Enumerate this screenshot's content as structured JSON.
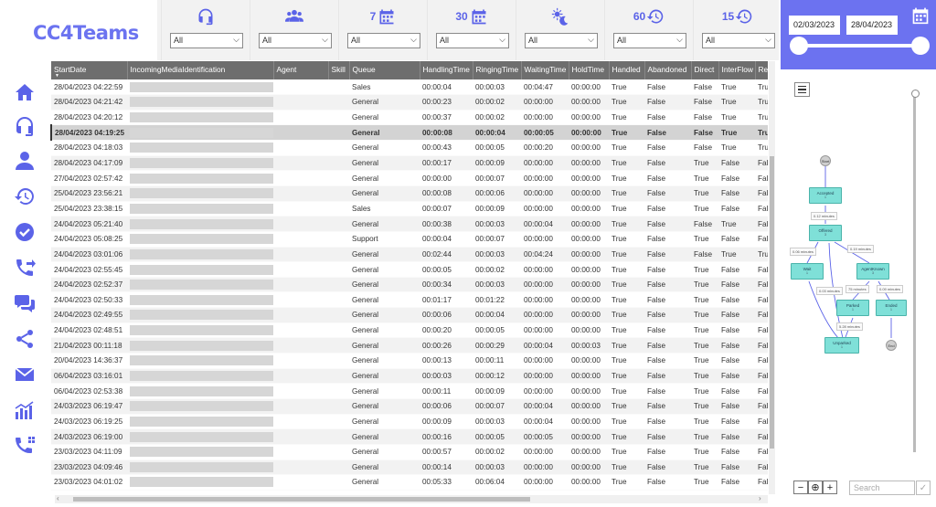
{
  "app": {
    "logo_text": "CC4Teams"
  },
  "sidebar": {
    "items": [
      {
        "icon": "home-icon"
      },
      {
        "icon": "headset-icon"
      },
      {
        "icon": "person-icon"
      },
      {
        "icon": "history-icon"
      },
      {
        "icon": "check-circle-icon"
      },
      {
        "icon": "phone-transfer-icon"
      },
      {
        "icon": "chat-icon"
      },
      {
        "icon": "share-icon"
      },
      {
        "icon": "mail-icon"
      },
      {
        "icon": "chart-icon"
      },
      {
        "icon": "phone-network-icon"
      }
    ]
  },
  "filters": [
    {
      "icon": "headset-icon",
      "label": "",
      "value": "All"
    },
    {
      "icon": "group-icon",
      "label": "",
      "value": "All"
    },
    {
      "icon": "calendar-icon",
      "label": "7",
      "value": "All"
    },
    {
      "icon": "calendar-icon",
      "label": "30",
      "value": "All"
    },
    {
      "icon": "day-night-icon",
      "label": "",
      "value": "All"
    },
    {
      "icon": "history-icon",
      "label": "60",
      "value": "All"
    },
    {
      "icon": "history-icon",
      "label": "15",
      "value": "All"
    }
  ],
  "date_range": {
    "start": "02/03/2023",
    "end": "28/04/2023"
  },
  "table": {
    "columns": [
      "StartDate",
      "IncomingMediaIdentification",
      "Agent",
      "Skill",
      "Queue",
      "HandlingTime",
      "RingingTime",
      "WaitingTime",
      "HoldTime",
      "Handled",
      "Abandoned",
      "Direct",
      "InterFlow",
      "Re"
    ],
    "rows": [
      [
        "28/04/2023 04:22:59",
        "Sales",
        "00:00:04",
        "00:00:03",
        "00:04:47",
        "00:00:00",
        "True",
        "False",
        "False",
        "True",
        "True"
      ],
      [
        "28/04/2023 04:21:42",
        "General",
        "00:00:23",
        "00:00:02",
        "00:00:00",
        "00:00:00",
        "True",
        "False",
        "False",
        "True",
        "True"
      ],
      [
        "28/04/2023 04:20:12",
        "General",
        "00:00:37",
        "00:00:02",
        "00:00:00",
        "00:00:00",
        "True",
        "False",
        "False",
        "True",
        "True"
      ],
      [
        "28/04/2023 04:19:25",
        "General",
        "00:00:08",
        "00:00:04",
        "00:00:05",
        "00:00:00",
        "True",
        "False",
        "False",
        "True",
        "True"
      ],
      [
        "28/04/2023 04:18:03",
        "General",
        "00:00:43",
        "00:00:05",
        "00:00:20",
        "00:00:00",
        "True",
        "False",
        "False",
        "True",
        "True"
      ],
      [
        "28/04/2023 04:17:09",
        "General",
        "00:00:17",
        "00:00:09",
        "00:00:00",
        "00:00:00",
        "True",
        "False",
        "True",
        "False",
        "Fals"
      ],
      [
        "27/04/2023 02:57:42",
        "General",
        "00:00:00",
        "00:00:07",
        "00:00:00",
        "00:00:00",
        "True",
        "False",
        "True",
        "False",
        "Fals"
      ],
      [
        "25/04/2023 23:56:21",
        "General",
        "00:00:08",
        "00:00:06",
        "00:00:00",
        "00:00:00",
        "True",
        "False",
        "True",
        "False",
        "Fals"
      ],
      [
        "25/04/2023 23:38:15",
        "Sales",
        "00:00:07",
        "00:00:09",
        "00:00:00",
        "00:00:00",
        "True",
        "False",
        "True",
        "False",
        "Fals"
      ],
      [
        "24/04/2023 05:21:40",
        "General",
        "00:00:38",
        "00:00:03",
        "00:00:04",
        "00:00:00",
        "True",
        "False",
        "False",
        "True",
        "Fals"
      ],
      [
        "24/04/2023 05:08:25",
        "Support",
        "00:00:04",
        "00:00:07",
        "00:00:00",
        "00:00:00",
        "True",
        "False",
        "True",
        "False",
        "Fals"
      ],
      [
        "24/04/2023 03:01:06",
        "General",
        "00:02:44",
        "00:00:03",
        "00:04:24",
        "00:00:00",
        "True",
        "False",
        "False",
        "True",
        "True"
      ],
      [
        "24/04/2023 02:55:45",
        "General",
        "00:00:05",
        "00:00:02",
        "00:00:00",
        "00:00:00",
        "True",
        "False",
        "True",
        "False",
        "Fals"
      ],
      [
        "24/04/2023 02:52:37",
        "General",
        "00:00:34",
        "00:00:03",
        "00:00:00",
        "00:00:00",
        "True",
        "False",
        "True",
        "False",
        "Fals"
      ],
      [
        "24/04/2023 02:50:33",
        "General",
        "00:01:17",
        "00:01:22",
        "00:00:00",
        "00:00:00",
        "True",
        "False",
        "True",
        "False",
        "Fals"
      ],
      [
        "24/04/2023 02:49:55",
        "General",
        "00:00:06",
        "00:00:04",
        "00:00:00",
        "00:00:00",
        "True",
        "False",
        "True",
        "False",
        "Fals"
      ],
      [
        "24/04/2023 02:48:51",
        "General",
        "00:00:20",
        "00:00:05",
        "00:00:00",
        "00:00:00",
        "True",
        "False",
        "True",
        "False",
        "Fals"
      ],
      [
        "21/04/2023 00:11:18",
        "General",
        "00:00:26",
        "00:00:29",
        "00:00:04",
        "00:00:03",
        "True",
        "False",
        "True",
        "False",
        "Fals"
      ],
      [
        "20/04/2023 14:36:37",
        "General",
        "00:00:13",
        "00:00:11",
        "00:00:00",
        "00:00:00",
        "True",
        "False",
        "True",
        "False",
        "Fals"
      ],
      [
        "06/04/2023 03:16:01",
        "General",
        "00:00:03",
        "00:00:12",
        "00:00:00",
        "00:00:00",
        "True",
        "False",
        "True",
        "False",
        "Fals"
      ],
      [
        "06/04/2023 02:53:38",
        "General",
        "00:00:11",
        "00:00:09",
        "00:00:00",
        "00:00:00",
        "True",
        "False",
        "True",
        "False",
        "Fals"
      ],
      [
        "24/03/2023 06:19:47",
        "General",
        "00:00:06",
        "00:00:07",
        "00:00:04",
        "00:00:00",
        "True",
        "False",
        "True",
        "False",
        "Fals"
      ],
      [
        "24/03/2023 06:19:25",
        "General",
        "00:00:09",
        "00:00:03",
        "00:00:04",
        "00:00:00",
        "True",
        "False",
        "True",
        "False",
        "Fals"
      ],
      [
        "24/03/2023 06:19:00",
        "General",
        "00:00:16",
        "00:00:05",
        "00:00:05",
        "00:00:00",
        "True",
        "False",
        "True",
        "False",
        "Fals"
      ],
      [
        "23/03/2023 04:11:09",
        "General",
        "00:00:57",
        "00:00:02",
        "00:00:00",
        "00:00:00",
        "True",
        "False",
        "True",
        "False",
        "Fals"
      ],
      [
        "23/03/2023 04:09:46",
        "General",
        "00:00:14",
        "00:00:03",
        "00:00:00",
        "00:00:00",
        "True",
        "False",
        "True",
        "False",
        "Fals"
      ],
      [
        "23/03/2023 04:01:02",
        "General",
        "00:05:33",
        "00:06:04",
        "00:00:00",
        "00:00:00",
        "True",
        "False",
        "True",
        "False",
        "Fals"
      ]
    ],
    "selected_row": 3
  },
  "process_map": {
    "nodes": {
      "start": "Start",
      "accepted": "Accepted",
      "accepted_count": "1",
      "offered": "Offered",
      "offered_count": "3",
      "wait": "Wait",
      "wait_count": "1",
      "agentknown": "AgentKnown",
      "agentknown_count": "3",
      "parked": "Parked",
      "parked_count": "1",
      "ended": "Ended",
      "ended_count": "1",
      "unparked": "Unparked",
      "unparked_count": "1",
      "end": "End"
    },
    "edge_labels": [
      "0.12 minutes",
      "0.06 minutes",
      "0.19 minutes",
      "0.03 minutes",
      "75 minutes",
      "0.09 minutes",
      "5.28 minutes"
    ],
    "search_placeholder": "Search"
  }
}
